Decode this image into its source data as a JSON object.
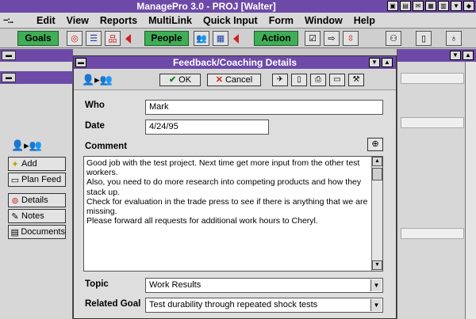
{
  "app": {
    "title": "ManagePro 3.0 - PROJ [Walter]"
  },
  "menubar": {
    "sysmenu": "−:..",
    "items": [
      {
        "label": "Edit"
      },
      {
        "label": "View"
      },
      {
        "label": "Reports"
      },
      {
        "label": "MultiLink"
      },
      {
        "label": "Quick Input"
      },
      {
        "label": "Form"
      },
      {
        "label": "Window"
      },
      {
        "label": "Help"
      }
    ]
  },
  "toolbar": {
    "groups": {
      "goals": "Goals",
      "people": "People",
      "action": "Action"
    }
  },
  "sidebar": {
    "buttons": {
      "add": "Add",
      "plan_feed": "Plan Feed",
      "details": "Details",
      "notes": "Notes",
      "documents": "Documents"
    }
  },
  "dialog": {
    "title": "Feedback/Coaching Details",
    "ok_label": "OK",
    "cancel_label": "Cancel",
    "who_label": "Who",
    "who_value": "Mark",
    "date_label": "Date",
    "date_value": "4/24/95",
    "comment_label": "Comment",
    "comment_lines": [
      "Good job with the test project. Next time get more input from the other test",
      "workers.",
      "Also, you need to do more research into competing products and how they",
      "stack up.",
      "Check for evaluation in the trade press to see if there is anything that we are",
      "missing.",
      "Please forward all requests for additional work hours to Cheryl."
    ],
    "topic_label": "Topic",
    "topic_value": "Work Results",
    "related_goal_label": "Related Goal",
    "related_goal_value": "Test durability through repeated shock tests"
  },
  "colors": {
    "titlebar": "#6e4aa8",
    "group_green": "#3fae57",
    "accent_red": "#c22222"
  }
}
